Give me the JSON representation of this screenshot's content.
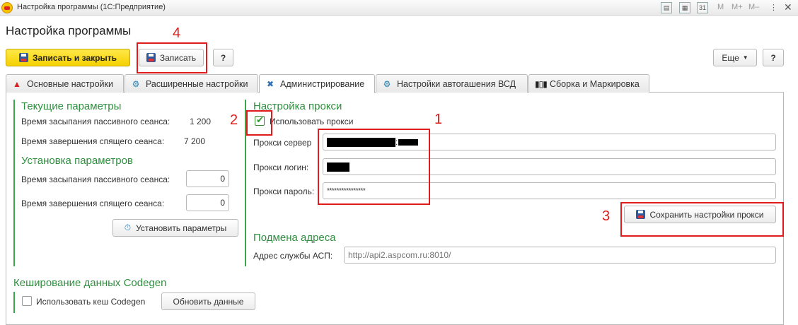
{
  "window": {
    "title": "Настройка программы (1С:Предприятие)",
    "tools": [
      "M",
      "M+",
      "M–"
    ]
  },
  "page": {
    "title": "Настройка программы"
  },
  "toolbar": {
    "save_close_label": "Записать и закрыть",
    "save_label": "Записать",
    "help_label": "?",
    "more_label": "Еще",
    "help2_label": "?"
  },
  "tabs": [
    {
      "label": "Основные настройки",
      "icon": "warning-icon"
    },
    {
      "label": "Расширенные настройки",
      "icon": "gear-icon"
    },
    {
      "label": "Администрирование",
      "icon": "tools-icon",
      "active": true
    },
    {
      "label": "Настройки автогашения ВСД",
      "icon": "settings-icon"
    },
    {
      "label": "Сборка и Маркировка",
      "icon": "barcode-icon"
    }
  ],
  "current": {
    "title": "Текущие параметры",
    "sleep_label": "Время засыпания пассивного сеанса:",
    "sleep_value": "1 200",
    "end_label": "Время завершения спящего сеанса:",
    "end_value": "7 200"
  },
  "setup": {
    "title": "Установка параметров",
    "sleep_label": "Время засыпания пассивного сеанса:",
    "sleep_value": "0",
    "end_label": "Время завершения спящего сеанса:",
    "end_value": "0",
    "apply_label": "Установить параметры"
  },
  "proxy": {
    "title": "Настройка прокси",
    "use_label": "Использовать прокси",
    "use_checked": true,
    "server_label": "Прокси сервер",
    "server_separator": ":",
    "login_label": "Прокси логин:",
    "password_label": "Прокси пароль:",
    "password_value": "****************",
    "save_label": "Сохранить настройки прокси"
  },
  "address": {
    "title": "Подмена адреса",
    "asp_label": "Адрес службы АСП:",
    "asp_placeholder": "http://api2.aspcom.ru:8010/"
  },
  "cache": {
    "title": "Кеширование данных Codegen",
    "use_label": "Использовать кеш Codegen",
    "refresh_label": "Обновить данные"
  },
  "annotations": [
    "1",
    "2",
    "3",
    "4"
  ],
  "colors": {
    "annotation": "#e01b1b",
    "section_title": "#2f8f3f",
    "accent_button": "#f5d000"
  }
}
